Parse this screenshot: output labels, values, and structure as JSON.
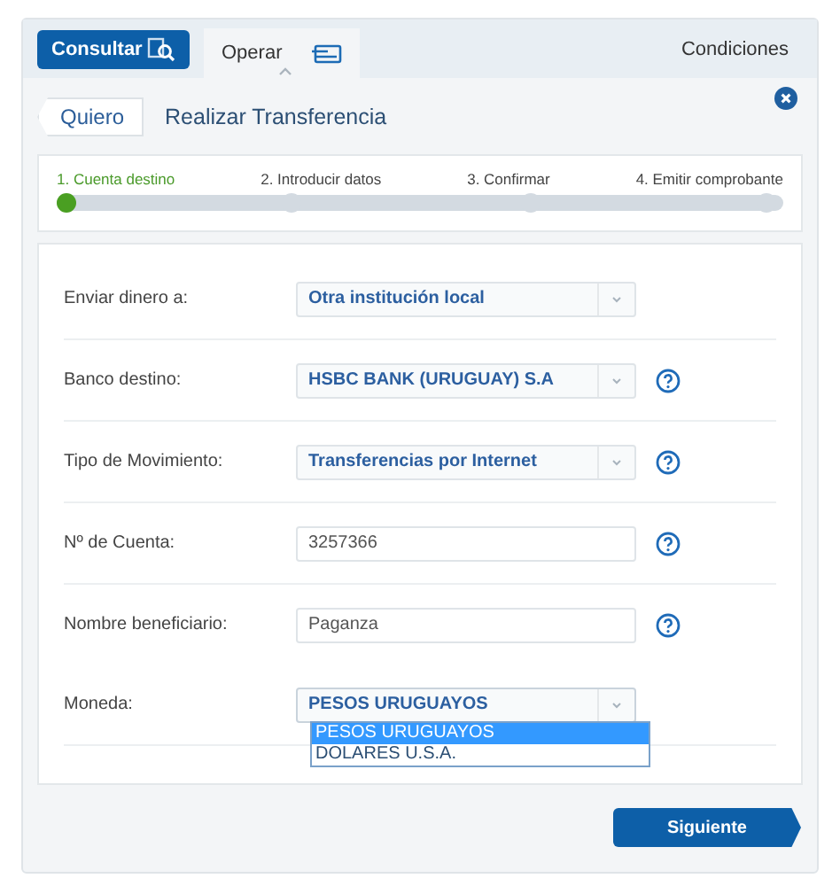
{
  "tabs": [
    {
      "label": "Consultar",
      "kind": "button",
      "selected": false
    },
    {
      "label": "Operar",
      "kind": "tab",
      "selected": true
    }
  ],
  "conditions_link": "Condiciones",
  "back_label": "Quiero",
  "title": "Realizar Transferencia",
  "steps": [
    {
      "label": "1. Cuenta destino",
      "selected": true
    },
    {
      "label": "2. Introducir datos",
      "selected": false
    },
    {
      "label": "3. Confirmar",
      "selected": false
    },
    {
      "label": "4. Emitir comprobante",
      "selected": false
    }
  ],
  "form_rows": [
    {
      "label": "Enviar dinero a:",
      "kind": "select",
      "value": "Otra institución local",
      "help": false
    },
    {
      "label": "Banco destino:",
      "kind": "select",
      "value": "HSBC BANK (URUGUAY) S.A",
      "help": true
    },
    {
      "label": "Tipo de Movimiento:",
      "kind": "select",
      "value": "Transferencias por Internet",
      "help": true
    },
    {
      "label": "Nº de Cuenta:",
      "kind": "input",
      "value": "3257366",
      "help": true
    },
    {
      "label": "Nombre beneficiario:",
      "kind": "input",
      "value": "Paganza",
      "help": true
    },
    {
      "label": "Moneda:",
      "kind": "select",
      "value": "PESOS URUGUAYOS",
      "help": false,
      "expanded": true,
      "options": [
        {
          "label": "PESOS URUGUAYOS",
          "selected": true
        },
        {
          "label": "DOLARES U.S.A.",
          "selected": false
        }
      ]
    }
  ],
  "next_button": "Siguiente"
}
